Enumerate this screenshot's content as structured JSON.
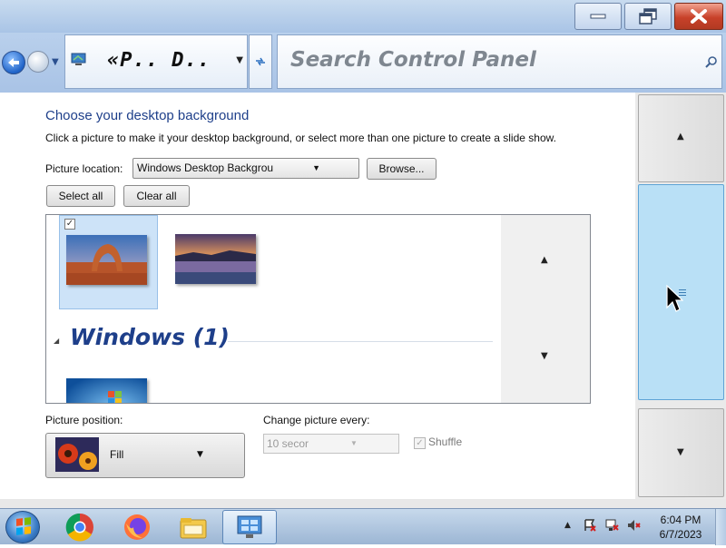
{
  "window": {
    "minimize_icon": "minimize-icon",
    "maximize_icon": "restore-icon",
    "close_icon": "close-icon"
  },
  "address_bar": {
    "path_text": "«P..  D..",
    "search_placeholder": "Search Control Panel"
  },
  "content": {
    "heading": "Choose your desktop background",
    "description": "Click a picture to make it your desktop background, or select more than one picture to create a slide show.",
    "picture_location_label": "Picture location:",
    "picture_location_value": "Windows Desktop Backgrou",
    "browse_label": "Browse...",
    "select_all_label": "Select all",
    "clear_all_label": "Clear all",
    "group_header": "Windows  (1)",
    "picture_position_label": "Picture position:",
    "picture_position_value": "Fill",
    "change_picture_label": "Change picture every:",
    "change_picture_value": "10 secor",
    "shuffle_label": "Shuffle",
    "shuffle_checked": true
  },
  "taskbar": {
    "apps": [
      "chrome-icon",
      "firefox-icon",
      "file-explorer-icon",
      "control-panel-icon"
    ],
    "clock_time": "6:04 PM",
    "clock_date": "6/7/2023"
  }
}
